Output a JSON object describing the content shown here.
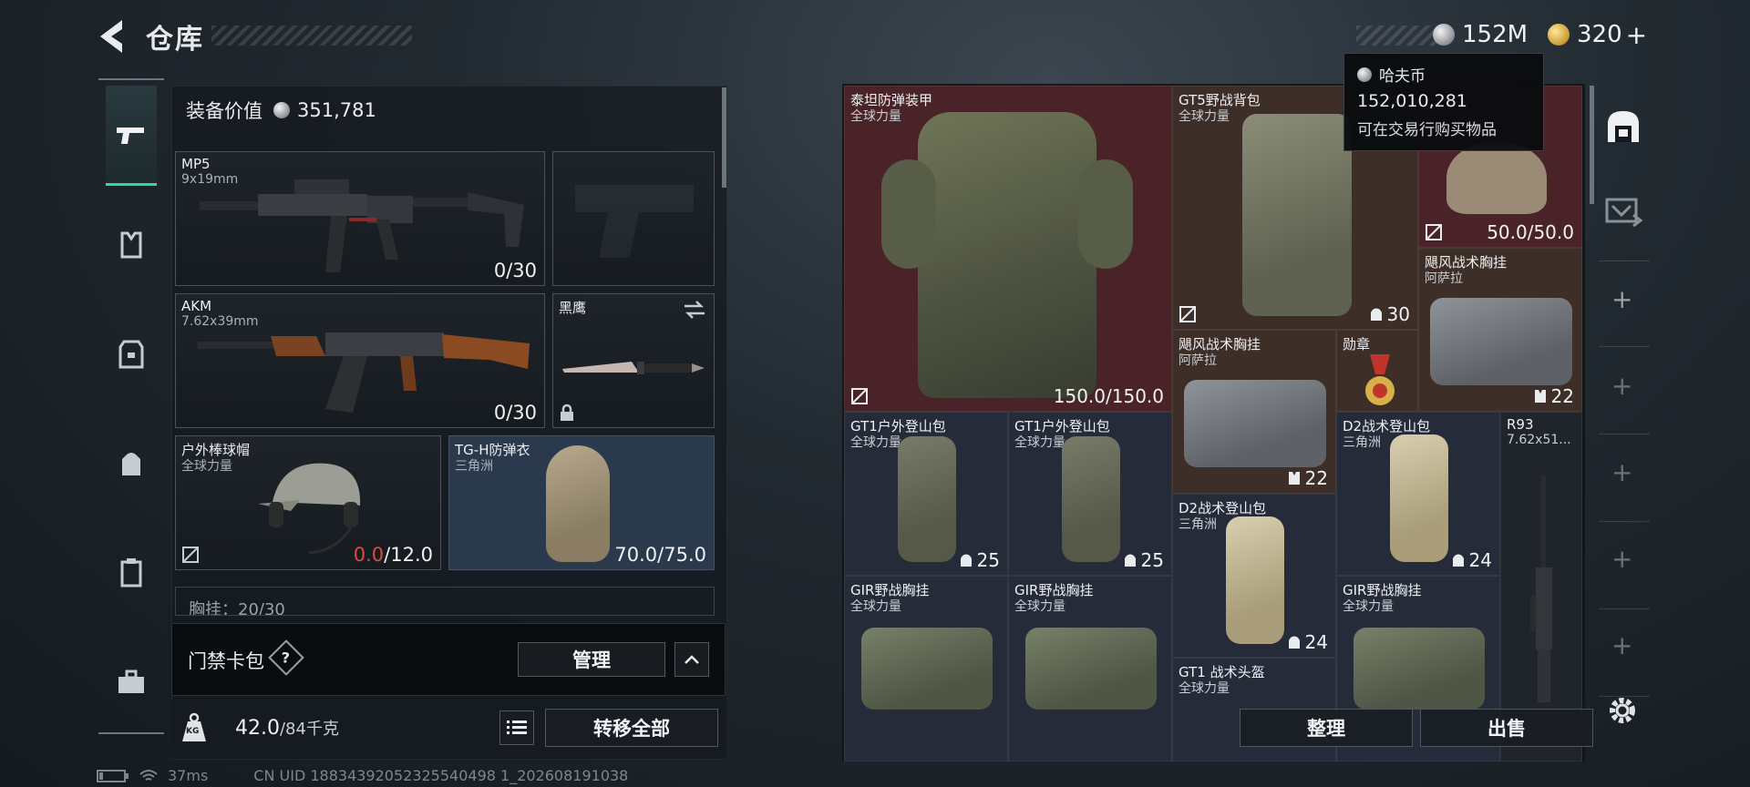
{
  "header": {
    "title": "仓库",
    "currency_silver": "152M",
    "currency_gold": "320"
  },
  "tooltip": {
    "title": "哈夫币",
    "amount": "152,010,281",
    "description": "可在交易行购买物品"
  },
  "equipment": {
    "value_label": "装备价值",
    "value": "351,781",
    "slots": [
      {
        "name": "MP5",
        "sub": "9x19mm",
        "count": "0/30"
      },
      {
        "name": "AKM",
        "sub": "7.62x39mm",
        "count": "0/30"
      },
      {
        "name": "黑鹰",
        "sub": ""
      },
      {
        "name": "户外棒球帽",
        "sub": "全球力量",
        "count_red": "0.0",
        "count_rest": "/12.0"
      },
      {
        "name": "TG-H防弹衣",
        "sub": "三角洲",
        "count": "70.0/75.0"
      }
    ],
    "partial_row": "胸挂：20/30",
    "keycard_label": "门禁卡包",
    "help": "?",
    "manage_label": "管理",
    "weight_value": "42.0",
    "weight_rest": "/84千克",
    "transfer_all_label": "转移全部",
    "kg_badge": "KG"
  },
  "warehouse": {
    "items": [
      {
        "name": "泰坦防弹装甲",
        "sub": "全球力量",
        "count": "150.0/150.0"
      },
      {
        "name": "GT5野战背包",
        "sub": "全球力量",
        "count": "30"
      },
      {
        "name": "",
        "sub": "",
        "count": "50.0/50.0"
      },
      {
        "name": "飓风战术胸挂",
        "sub": "阿萨拉",
        "count": "22"
      },
      {
        "name": "飓风战术胸挂",
        "sub": "阿萨拉",
        "count": "22"
      },
      {
        "name": "勋章",
        "sub": ""
      },
      {
        "name": "GT1户外登山包",
        "sub": "全球力量",
        "count": "25"
      },
      {
        "name": "GT1户外登山包",
        "sub": "全球力量",
        "count": "25"
      },
      {
        "name": "D2战术登山包",
        "sub": "三角洲",
        "count": "24"
      },
      {
        "name": "D2战术登山包",
        "sub": "三角洲",
        "count": "24"
      },
      {
        "name": "R93",
        "sub": "7.62x51..."
      },
      {
        "name": "GIR野战胸挂",
        "sub": "全球力量"
      },
      {
        "name": "GIR野战胸挂",
        "sub": "全球力量"
      },
      {
        "name": "GIR野战胸挂",
        "sub": "全球力量"
      },
      {
        "name": "GT1 战术头盔",
        "sub": "全球力量"
      }
    ],
    "sort_label": "整理",
    "sell_label": "出售"
  },
  "status": {
    "ping": "37ms",
    "uid": "CN UID 18834392052325540498 1_202608191038"
  },
  "colors": {
    "accent": "#2fd6a8",
    "red_tier": "#4a2328",
    "brown_tier": "#3d2e28",
    "blue_tier": "#262b3a",
    "low_durability": "#e04a3c"
  }
}
